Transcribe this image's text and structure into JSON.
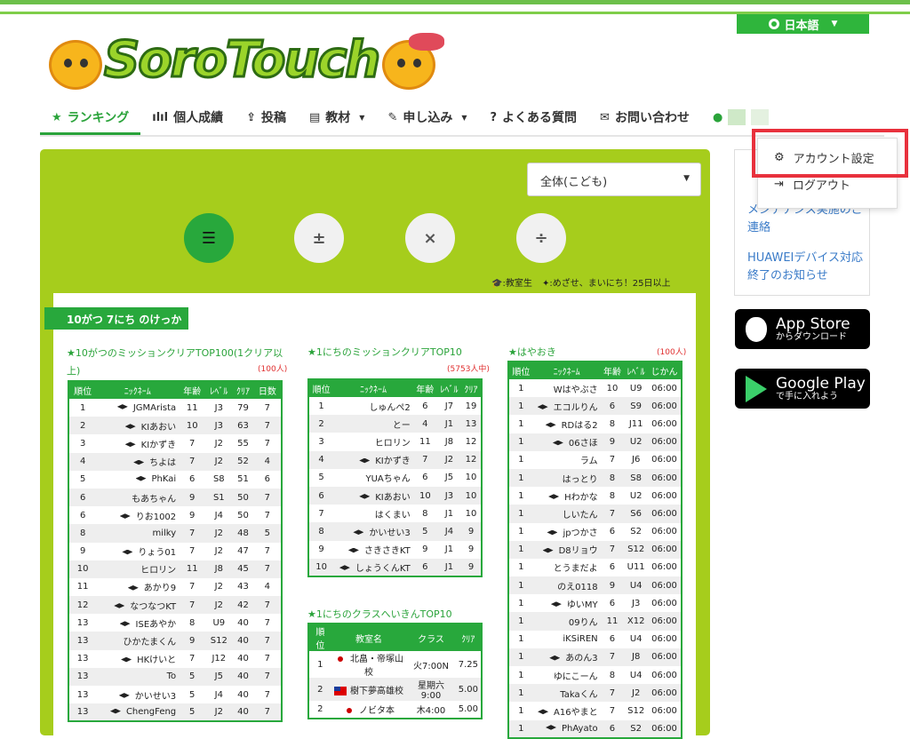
{
  "header": {
    "language": "日本語",
    "logo_text": "SoroTouch"
  },
  "nav": [
    {
      "label": "ランキング",
      "icon": "star-icon"
    },
    {
      "label": "個人成績",
      "icon": "bar-chart-icon"
    },
    {
      "label": "投稿",
      "icon": "upload-icon"
    },
    {
      "label": "教材",
      "icon": "book-icon"
    },
    {
      "label": "申し込み",
      "icon": "edit-icon"
    },
    {
      "label": "よくある質問",
      "icon": "question-icon"
    },
    {
      "label": "お問い合わせ",
      "icon": "mail-icon"
    }
  ],
  "user_menu": {
    "account_settings": "アカウント設定",
    "logout": "ログアウト"
  },
  "side": {
    "notice1": "メンテナンス実施のご連絡",
    "notice2": "HUAWEIデバイス対応終了のお知らせ",
    "appstore_big": "App Store",
    "appstore_small": "からダウンロード",
    "gplay_big": "Google Play",
    "gplay_small": "で手に入れよう"
  },
  "filter": {
    "selected": "全体(こども)"
  },
  "calc_buttons": [
    "±",
    "×",
    "÷"
  ],
  "legend": {
    "student": ":教室生",
    "daily": ":めざせ、まいにち！25日以上"
  },
  "day_tab": "10がつ 7にち のけっか",
  "monthly": {
    "title": "★10がつのミッションクリアTOP100(1クリア以上)",
    "count": "(100人)",
    "headers": [
      "順位",
      "ﾆｯｸﾈｰﾑ",
      "年齢",
      "ﾚﾍﾞﾙ",
      "ｸﾘｱ",
      "日数"
    ],
    "rows": [
      [
        "1",
        "JGMArista",
        "11",
        "J3",
        "79",
        "7"
      ],
      [
        "2",
        "KIあおい",
        "10",
        "J3",
        "63",
        "7"
      ],
      [
        "3",
        "KIかずき",
        "7",
        "J2",
        "55",
        "7"
      ],
      [
        "4",
        "ちよは",
        "7",
        "J2",
        "52",
        "4"
      ],
      [
        "5",
        "PhKai",
        "6",
        "S8",
        "51",
        "6"
      ],
      [
        "6",
        "もあちゃん",
        "9",
        "S1",
        "50",
        "7"
      ],
      [
        "6",
        "りお1002",
        "9",
        "J4",
        "50",
        "7"
      ],
      [
        "8",
        "milky",
        "7",
        "J2",
        "48",
        "5"
      ],
      [
        "9",
        "りょう01",
        "7",
        "J2",
        "47",
        "7"
      ],
      [
        "10",
        "ヒロリン",
        "11",
        "J8",
        "45",
        "7"
      ],
      [
        "11",
        "あかり9",
        "7",
        "J2",
        "43",
        "4"
      ],
      [
        "12",
        "なつなつKT",
        "7",
        "J2",
        "42",
        "7"
      ],
      [
        "13",
        "ISEあやか",
        "8",
        "U9",
        "40",
        "7"
      ],
      [
        "13",
        "ひかたまくん",
        "9",
        "S12",
        "40",
        "7"
      ],
      [
        "13",
        "HKけいと",
        "7",
        "J12",
        "40",
        "7"
      ],
      [
        "13",
        "To",
        "5",
        "J5",
        "40",
        "7"
      ],
      [
        "13",
        "かいせい3",
        "5",
        "J4",
        "40",
        "7"
      ],
      [
        "13",
        "ChengFeng",
        "5",
        "J2",
        "40",
        "7"
      ]
    ]
  },
  "daily": {
    "title": "★1にちのミッションクリアTOP10",
    "count": "(5753人中)",
    "headers": [
      "順位",
      "ﾆｯｸﾈｰﾑ",
      "年齢",
      "ﾚﾍﾞﾙ",
      "ｸﾘｱ"
    ],
    "rows": [
      [
        "1",
        "しゅんぺ2",
        "6",
        "J7",
        "19"
      ],
      [
        "2",
        "とー",
        "4",
        "J1",
        "13"
      ],
      [
        "3",
        "ヒロリン",
        "11",
        "J8",
        "12"
      ],
      [
        "4",
        "KIかずき",
        "7",
        "J2",
        "12"
      ],
      [
        "5",
        "YUAちゃん",
        "6",
        "J5",
        "10"
      ],
      [
        "6",
        "KIあおい",
        "10",
        "J3",
        "10"
      ],
      [
        "7",
        "はくまい",
        "8",
        "J1",
        "10"
      ],
      [
        "8",
        "かいせい3",
        "5",
        "J4",
        "9"
      ],
      [
        "9",
        "さきさきKT",
        "9",
        "J1",
        "9"
      ],
      [
        "10",
        "しょうくんKT",
        "6",
        "J1",
        "9"
      ]
    ]
  },
  "class": {
    "title": "★1にちのクラスへいきんTOP10",
    "headers": [
      "順位",
      "教室名",
      "クラス",
      "ｸﾘｱ"
    ],
    "rows": [
      [
        "1",
        "北畠・帝塚山校",
        "火7:00N",
        "7.25"
      ],
      [
        "2",
        "樹下夢高雄校",
        "星期六9:00",
        "5.00"
      ],
      [
        "2",
        "ノビタ本",
        "木4:00",
        "5.00"
      ]
    ]
  },
  "fast": {
    "title": "★はやおき",
    "count": "(100人)",
    "headers": [
      "順位",
      "ﾆｯｸﾈｰﾑ",
      "年齢",
      "ﾚﾍﾞﾙ",
      "じかん"
    ],
    "rows": [
      [
        "1",
        "Wはやぶさ",
        "10",
        "U9",
        "06:00"
      ],
      [
        "1",
        "エコルりん",
        "6",
        "S9",
        "06:00"
      ],
      [
        "1",
        "RDはる2",
        "8",
        "J11",
        "06:00"
      ],
      [
        "1",
        "06さほ",
        "9",
        "U2",
        "06:00"
      ],
      [
        "1",
        "ラム",
        "7",
        "J6",
        "06:00"
      ],
      [
        "1",
        "はっとり",
        "8",
        "S8",
        "06:00"
      ],
      [
        "1",
        "Hわかな",
        "8",
        "U2",
        "06:00"
      ],
      [
        "1",
        "しいたん",
        "7",
        "S6",
        "06:00"
      ],
      [
        "1",
        "jpつかさ",
        "6",
        "S2",
        "06:00"
      ],
      [
        "1",
        "D8リョウ",
        "7",
        "S12",
        "06:00"
      ],
      [
        "1",
        "とうまだよ",
        "6",
        "U11",
        "06:00"
      ],
      [
        "1",
        "のえ0118",
        "9",
        "U4",
        "06:00"
      ],
      [
        "1",
        "ゆいMY",
        "6",
        "J3",
        "06:00"
      ],
      [
        "1",
        "09りん",
        "11",
        "X12",
        "06:00"
      ],
      [
        "1",
        "iKSiREN",
        "6",
        "U4",
        "06:00"
      ],
      [
        "1",
        "あのん3",
        "7",
        "J8",
        "06:00"
      ],
      [
        "1",
        "ゆにこーん",
        "8",
        "U4",
        "06:00"
      ],
      [
        "1",
        "Takaくん",
        "7",
        "J2",
        "06:00"
      ],
      [
        "1",
        "A16やまと",
        "7",
        "S12",
        "06:00"
      ],
      [
        "1",
        "PhAyato",
        "6",
        "S2",
        "06:00"
      ]
    ]
  }
}
